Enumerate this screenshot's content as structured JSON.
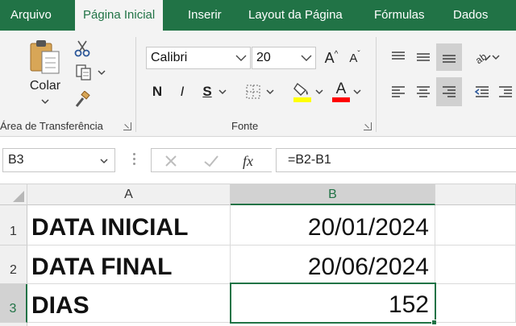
{
  "menu": {
    "tabs": [
      {
        "label": "Arquivo"
      },
      {
        "label": "Página Inicial"
      },
      {
        "label": "Inserir"
      },
      {
        "label": "Layout da Página"
      },
      {
        "label": "Fórmulas"
      },
      {
        "label": "Dados"
      }
    ],
    "active_index": 1
  },
  "ribbon": {
    "clipboard": {
      "paste_label": "Colar",
      "group_label": "Área de Transferência"
    },
    "font": {
      "font_name": "Calibri",
      "font_size": "20",
      "bold_label": "N",
      "italic_label": "I",
      "underline_label": "S",
      "grow_label": "A",
      "shrink_label": "A",
      "color_label": "A",
      "group_label": "Fonte",
      "highlight_color": "#ffff00",
      "font_color": "#ff0000"
    }
  },
  "formula_bar": {
    "name_box": "B3",
    "formula": "=B2-B1"
  },
  "grid": {
    "columns": [
      "A",
      "B"
    ],
    "rows": [
      {
        "num": "1",
        "a": "DATA INICIAL",
        "b": "20/01/2024"
      },
      {
        "num": "2",
        "a": "DATA FINAL",
        "b": "20/06/2024"
      },
      {
        "num": "3",
        "a": "DIAS",
        "b": "152"
      }
    ],
    "active_cell": "B3"
  },
  "colors": {
    "accent": "#217346"
  }
}
